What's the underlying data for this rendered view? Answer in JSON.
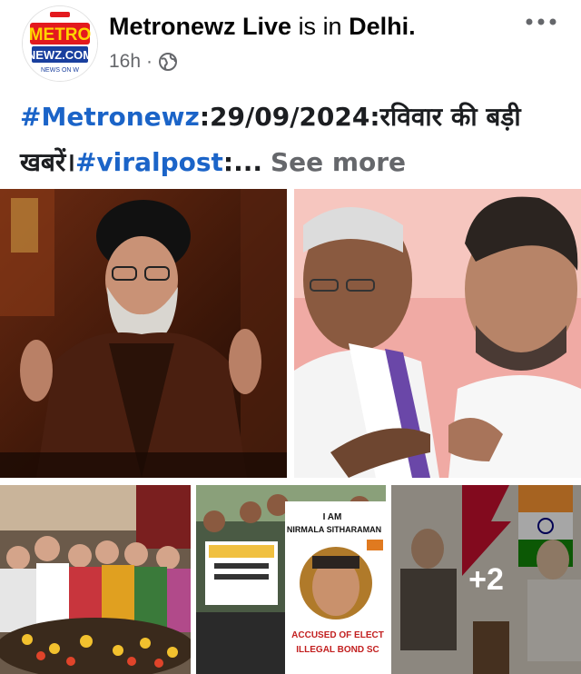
{
  "post": {
    "author": "Metronewz Live",
    "location_connector": "is in",
    "location": "Delhi",
    "time": "16h",
    "privacy_icon": "globe-icon",
    "more_icon": "more-dots-icon"
  },
  "avatar": {
    "logo_text_top": "METRO",
    "logo_text_bottom": "NEWZ.COM",
    "logo_tagline": "NEWS ON W"
  },
  "caption": {
    "tag1": "#Metronewz",
    "text1": ":29/09/2024:रविवार की बड़ी खबरें।",
    "tag2": "#viralpost",
    "text2": ":...",
    "see_more": "See more"
  },
  "photos": [
    {
      "id": "photo-1",
      "subject": "cleric-speech"
    },
    {
      "id": "photo-2",
      "subject": "politicians"
    },
    {
      "id": "photo-3",
      "subject": "ceremony-crowd"
    },
    {
      "id": "photo-4",
      "subject": "protest"
    },
    {
      "id": "photo-5",
      "subject": "diplomatic-meeting"
    }
  ],
  "protest_sign": {
    "line1": "I AM",
    "line2": "NIRMALA SITHARAMAN",
    "line3": "ACCUSED OF ELECT",
    "line4": "ILLEGAL BOND SC"
  },
  "more_photos_label": "+2",
  "colors": {
    "link_blue": "#1b64c8",
    "meta_gray": "#65676b",
    "text": "#050505",
    "logo_red": "#e3191e",
    "logo_blue": "#1a3f9e"
  }
}
